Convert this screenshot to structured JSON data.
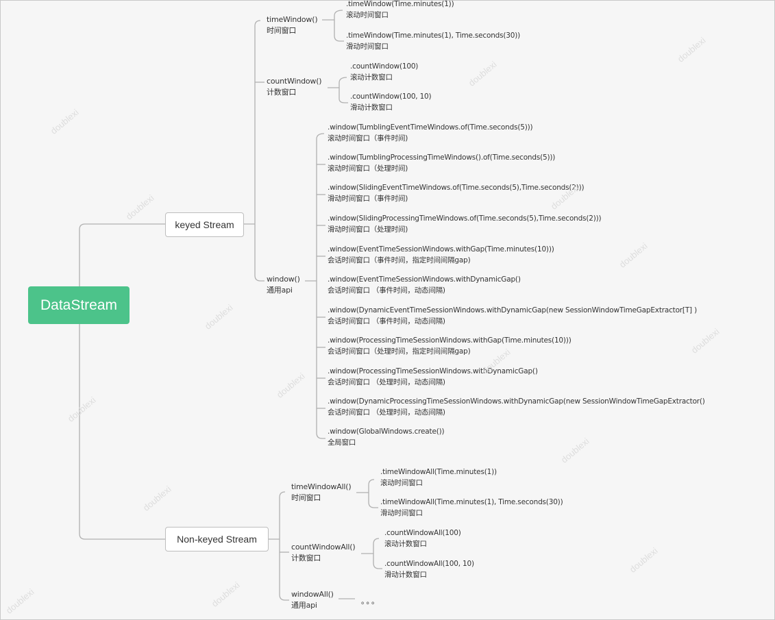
{
  "root": {
    "label": "DataStream",
    "color": "#4cc38a"
  },
  "keyed": {
    "label": "keyed Stream",
    "time_window": {
      "code": "timeWindow()",
      "desc": "时间窗口",
      "children": [
        {
          "code": ".timeWindow(Time.minutes(1))",
          "desc": "滚动时间窗口"
        },
        {
          "code": ".timeWindow(Time.minutes(1), Time.seconds(30))",
          "desc": "滑动时间窗口"
        }
      ]
    },
    "count_window": {
      "code": "countWindow()",
      "desc": "计数窗口",
      "children": [
        {
          "code": ".countWindow(100)",
          "desc": "滚动计数窗口"
        },
        {
          "code": ".countWindow(100, 10)",
          "desc": "滑动计数窗口"
        }
      ]
    },
    "window": {
      "code": "window()",
      "desc": "通用api",
      "children": [
        {
          "code": ".window(TumblingEventTimeWindows.of(Time.seconds(5)))",
          "desc": "滚动时间窗口（事件时间)"
        },
        {
          "code": ".window(TumblingProcessingTimeWindows().of(Time.seconds(5)))",
          "desc": "滚动时间窗口（处理时间)"
        },
        {
          "code": ".window(SlidingEventTimeWindows.of(Time.seconds(5),Time.seconds(2)))",
          "desc": "滑动时间窗口（事件时间)"
        },
        {
          "code": ".window(SlidingProcessingTimeWindows.of(Time.seconds(5),Time.seconds(2)))",
          "desc": "滑动时间窗口（处理时间)"
        },
        {
          "code": ".window(EventTimeSessionWindows.withGap(Time.minutes(10)))",
          "desc": "会话时间窗口（事件时间，指定时间间隔gap)"
        },
        {
          "code": ".window(EventTimeSessionWindows.withDynamicGap()",
          "desc": "会话时间窗口 （事件时间，动态间隔)"
        },
        {
          "code": ".window(DynamicEventTimeSessionWindows.withDynamicGap(new SessionWindowTimeGapExtractor[T] )",
          "desc": "会话时间窗口 （事件时间，动态间隔)"
        },
        {
          "code": ".window(ProcessingTimeSessionWindows.withGap(Time.minutes(10)))",
          "desc": "会话时间窗口（处理时间，指定时间间隔gap)"
        },
        {
          "code": ".window(ProcessingTimeSessionWindows.withDynamicGap()",
          "desc": "会话时间窗口 （处理时间，动态间隔)"
        },
        {
          "code": ".window(DynamicProcessingTimeSessionWindows.withDynamicGap(new SessionWindowTimeGapExtractor()",
          "desc": "会话时间窗口 （处理时间，动态间隔)"
        },
        {
          "code": ".window(GlobalWindows.create())",
          "desc": "全局窗口"
        }
      ]
    }
  },
  "non_keyed": {
    "label": "Non-keyed Stream",
    "time_window_all": {
      "code": "timeWindowAll()",
      "desc": "时间窗口",
      "children": [
        {
          "code": ".timeWindowAll(Time.minutes(1))",
          "desc": "滚动时间窗口"
        },
        {
          "code": ".timeWindowAll(Time.minutes(1), Time.seconds(30))",
          "desc": "滑动时间窗口"
        }
      ]
    },
    "count_window_all": {
      "code": "countWindowAll()",
      "desc": "计数窗口",
      "children": [
        {
          "code": ".countWindowAll(100)",
          "desc": "滚动计数窗口"
        },
        {
          "code": ".countWindowAll(100, 10)",
          "desc": "滑动计数窗口"
        }
      ]
    },
    "window_all": {
      "code": "windowAll()",
      "desc": "通用api",
      "ellipsis": "。。。"
    }
  },
  "watermark": "doublexi"
}
